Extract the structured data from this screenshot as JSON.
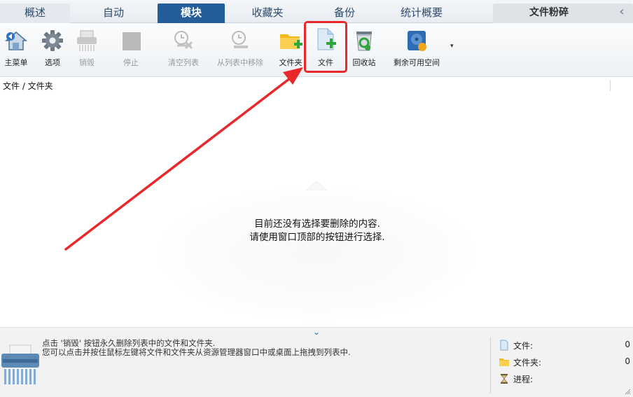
{
  "tabs": [
    {
      "label": "概述",
      "active": false
    },
    {
      "label": "自动",
      "active": false
    },
    {
      "label": "模块",
      "active": true
    },
    {
      "label": "收藏夹",
      "active": false
    },
    {
      "label": "备份",
      "active": false
    },
    {
      "label": "统计概要",
      "active": false
    }
  ],
  "shredder_tab": {
    "label": "文件粉碎"
  },
  "collapse_glyph": "‹",
  "toolbar": {
    "buttons": [
      {
        "label": "主菜单",
        "icon": "home-icon",
        "disabled": false
      },
      {
        "label": "选项",
        "icon": "gear-icon",
        "disabled": false
      },
      {
        "label": "销毁",
        "icon": "shredder-icon",
        "disabled": true
      },
      {
        "label": "停止",
        "icon": "stop-icon",
        "disabled": true
      },
      {
        "label": "清空列表",
        "icon": "clear-list-icon",
        "disabled": true
      },
      {
        "label": "从列表中移除",
        "icon": "remove-from-list-icon",
        "disabled": true
      },
      {
        "label": "文件夹",
        "icon": "add-folder-icon",
        "disabled": false
      },
      {
        "label": "文件",
        "icon": "add-file-icon",
        "disabled": false,
        "highlighted": true
      },
      {
        "label": "回收站",
        "icon": "recycle-bin-icon",
        "disabled": false
      },
      {
        "label": "剩余可用空间",
        "icon": "free-space-icon",
        "disabled": false
      }
    ],
    "more_glyph": "▾"
  },
  "column_header": "文件 / 文件夹",
  "empty_state": {
    "line1": "目前还没有选择要删除的内容.",
    "line2": "请使用窗口顶部的按钮进行选择."
  },
  "bottom": {
    "expand_glyph": "⌄",
    "hint_line1": "点击 '销毁' 按钮永久删除列表中的文件和文件夹.",
    "hint_line2": "您可以点击并按住鼠标左键将文件和文件夹从资源管理器窗口中或桌面上拖拽到列表中.",
    "stats": [
      {
        "label": "文件:",
        "value": "0",
        "icon": "file-icon"
      },
      {
        "label": "文件夹:",
        "value": "0",
        "icon": "folder-icon"
      },
      {
        "label": "进程:",
        "value": "",
        "icon": "hourglass-icon"
      }
    ]
  },
  "colors": {
    "active_tab": "#245d9a",
    "highlight": "#e8282b",
    "arrow": "#e8282b"
  }
}
